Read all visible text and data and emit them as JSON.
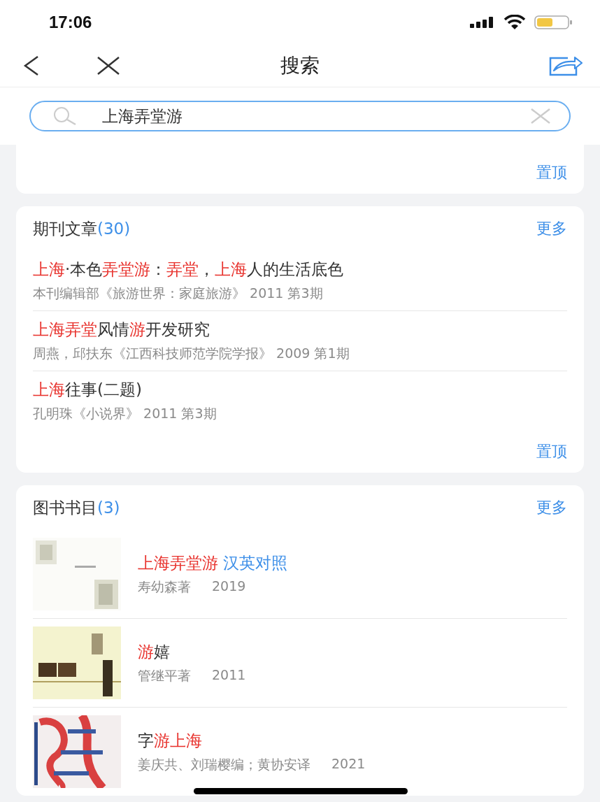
{
  "status_bar": {
    "time": "17:06"
  },
  "nav": {
    "title": "搜索"
  },
  "search": {
    "value": "上海弄堂游"
  },
  "top_card": {
    "pin": "置顶"
  },
  "sections": [
    {
      "kind": "articles",
      "title": "期刊文章",
      "count": "(30)",
      "more": "更多",
      "pin": "置顶",
      "items": [
        {
          "title": [
            {
              "text": "上海",
              "kind": "match"
            },
            {
              "text": "·本色",
              "kind": "plain"
            },
            {
              "text": "弄堂游",
              "kind": "match"
            },
            {
              "text": "：",
              "kind": "plain"
            },
            {
              "text": "弄堂",
              "kind": "match"
            },
            {
              "text": "，",
              "kind": "plain"
            },
            {
              "text": "上海",
              "kind": "match"
            },
            {
              "text": "人的生活底色",
              "kind": "plain"
            }
          ],
          "meta": "本刊编辑部《旅游世界：家庭旅游》 2011 第3期"
        },
        {
          "title": [
            {
              "text": "上海弄堂",
              "kind": "match"
            },
            {
              "text": "风情",
              "kind": "plain"
            },
            {
              "text": "游",
              "kind": "match"
            },
            {
              "text": "开发研究",
              "kind": "plain"
            }
          ],
          "meta": "周燕，邱扶东《江西科技师范学院学报》 2009 第1期"
        },
        {
          "title": [
            {
              "text": "上海",
              "kind": "match"
            },
            {
              "text": "往事(二题)",
              "kind": "plain"
            }
          ],
          "meta": "孔明珠《小说界》 2011 第3期"
        }
      ]
    },
    {
      "kind": "books",
      "title": "图书书目",
      "count": "(3)",
      "more": "更多",
      "items": [
        {
          "title": [
            {
              "text": "上海弄堂游",
              "kind": "match"
            },
            {
              "text": " 汉英对照",
              "kind": "tag"
            }
          ],
          "author": "寿幼森著",
          "year": "2019"
        },
        {
          "title": [
            {
              "text": "游",
              "kind": "match"
            },
            {
              "text": "嬉",
              "kind": "plain"
            }
          ],
          "author": "管继平著",
          "year": "2011"
        },
        {
          "title": [
            {
              "text": "字",
              "kind": "plain"
            },
            {
              "text": "游上海",
              "kind": "match"
            }
          ],
          "author": "姜庆共、刘瑞樱编；黄协安译",
          "year": "2021"
        }
      ]
    }
  ]
}
